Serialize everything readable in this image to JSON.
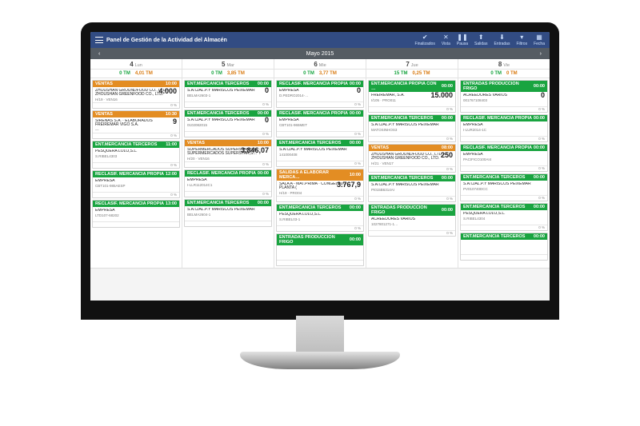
{
  "header": {
    "title": "Panel de Gestión de la Actividad del Almacén",
    "tools": [
      {
        "id": "finalizados",
        "label": "Finalizados",
        "glyph": "✔"
      },
      {
        "id": "vista",
        "label": "Vista",
        "glyph": "✕"
      },
      {
        "id": "pausa",
        "label": "Pausa",
        "glyph": "❚❚"
      },
      {
        "id": "salidas",
        "label": "Salidas",
        "glyph": "⬆"
      },
      {
        "id": "entradas",
        "label": "Entradas",
        "glyph": "⬇"
      },
      {
        "id": "filtros",
        "label": "Filtros",
        "glyph": "▾"
      },
      {
        "id": "fecha",
        "label": "Fecha",
        "glyph": "▦"
      }
    ]
  },
  "datebar": {
    "prev": "‹",
    "label": "Mayo 2015",
    "next": "›"
  },
  "days": [
    {
      "num": "4",
      "dow": "Lun",
      "in": "0 TM",
      "out": "4,01 TM",
      "cards": [
        {
          "cls": "orange",
          "title": "VENTAS",
          "time": "10:00",
          "company": "ZHOUSHAN GROUNDFOOD CO., LTD. · ZHOUSHAN GREENFOOD CO., LTD.",
          "ref": "H/19 · VEN16",
          "amount": "4.000",
          "pct": "0 %"
        },
        {
          "cls": "orange",
          "title": "VENTAS",
          "time": "10:30",
          "company": "SIRENAS S.A. · ELABORADOS FREIREMAR VIGO S.A.",
          "ref": "—",
          "amount": "9",
          "pct": "0 %"
        },
        {
          "cls": "green",
          "title": "ENT.MERCANCIA TERCEROS",
          "time": "11:00",
          "company": "PESQUERA LOLO,S.L.",
          "ref": "S.RIBEL4303",
          "amount": "",
          "pct": "0 %"
        },
        {
          "cls": "green",
          "title": "RECLASIF. MERCANCIA PROPIA",
          "time": "12:00",
          "company": "EMPRESA",
          "ref": "CBT101-985AESP",
          "amount": "",
          "pct": "0 %"
        },
        {
          "cls": "green",
          "title": "RECLASIF. MERCANCIA PROPIA",
          "time": "13:00",
          "company": "EMPRESA",
          "ref": "LTD107-68202",
          "amount": "",
          "pct": ""
        }
      ]
    },
    {
      "num": "5",
      "dow": "Mar",
      "in": "0 TM",
      "out": "3,85 TM",
      "cards": [
        {
          "cls": "green",
          "title": "ENT.MERCANCIA TERCEROS",
          "time": "00:00",
          "company": "S.A.CIAL.P.Y MARISCOS PEIXEMAR",
          "ref": "BELMA2603-1",
          "amount": "0",
          "pct": "0 %"
        },
        {
          "cls": "green",
          "title": "ENT.MERCANCIA TERCEROS",
          "time": "00:00",
          "company": "S.A.CIAL.P.Y MARISCOS PEIXEMAR",
          "ref": "0102082015",
          "amount": "0",
          "pct": "0 %"
        },
        {
          "cls": "orange",
          "title": "VENTAS",
          "time": "10:00",
          "company": "SUPERMERCADOS SUPERSTAR,S.A. · SUPERMERCADOS SUPERSTAR,S…",
          "ref": "H/20 · VEN16",
          "amount": "3.846,07",
          "pct": "0 %"
        },
        {
          "cls": "green",
          "title": "RECLASIF. MERCANCIA PROPIA",
          "time": "00:00",
          "company": "EMPRESA",
          "ref": "I-LLR112014C1",
          "amount": "",
          "pct": "0 %"
        },
        {
          "cls": "green",
          "title": "ENT.MERCANCIA TERCEROS",
          "time": "00:00",
          "company": "S.A.CIAL.P.Y MARISCOS PEIXEMAR",
          "ref": "BELMA2604-1",
          "amount": "",
          "pct": ""
        }
      ]
    },
    {
      "num": "6",
      "dow": "Mie",
      "in": "0 TM",
      "out": "3,77 TM",
      "cards": [
        {
          "cls": "green",
          "title": "RECLASIF. MERCANCIA PROPIA",
          "time": "00:00",
          "company": "EMPRESA",
          "ref": "D.PEDRO2014-…",
          "amount": "0",
          "pct": "0 %"
        },
        {
          "cls": "green",
          "title": "RECLASIF. MERCANCIA PROPIA",
          "time": "00:00",
          "company": "EMPRESA",
          "ref": "CBT101-965MET",
          "amount": "",
          "pct": "0 %"
        },
        {
          "cls": "green",
          "title": "ENT.MERCANCIA TERCEROS",
          "time": "00:00",
          "company": "S.A.CIAL.P.Y MARISCOS PEIXEMAR",
          "ref": "141000408",
          "amount": "",
          "pct": "0 %"
        },
        {
          "cls": "orange",
          "title": "SALIDAS A ELABORAR MERCA…",
          "time": "10:00",
          "company": "SALA A - MAT.PRIMA · CONGELADO PLANTA (",
          "ref": "H/19 · PRO04",
          "amount": "3.767,9",
          "pct": "0 %"
        },
        {
          "cls": "green",
          "title": "ENT.MERCANCIA TERCEROS",
          "time": "00:00",
          "company": "PESQUERA LOLO,S.L.",
          "ref": "S.RIBEL03-1",
          "amount": "",
          "pct": "0 %"
        },
        {
          "cls": "green",
          "title": "ENTRADAS PRODUCCION FRIGO",
          "time": "00:00",
          "company": "",
          "ref": "",
          "amount": "",
          "pct": ""
        }
      ]
    },
    {
      "num": "7",
      "dow": "Jue",
      "in": "15 TM",
      "out": "0,25 TM",
      "cards": [
        {
          "cls": "green",
          "title": "ENT.MERCANCIA PROPIA CON …",
          "time": "00:00",
          "company": "FREIREMAR, S.A.",
          "ref": "I/105 · PRO011",
          "amount": "15.000",
          "pct": "0 %"
        },
        {
          "cls": "green",
          "title": "ENT.MERCANCIA TERCEROS",
          "time": "00:00",
          "company": "S.A.CIAL.P.Y MARISCOS PEIXEMAR",
          "ref": "MATOSINHOS3",
          "amount": "",
          "pct": "0 %"
        },
        {
          "cls": "orange",
          "title": "VENTAS",
          "time": "08:00",
          "company": "ZHOUSHAN GROUNDFOOD CO., LTD. · ZHOUSHAN GREENFOOD CO., LTD.",
          "ref": "H/21 · VEN17",
          "amount": "250",
          "pct": "0 %"
        },
        {
          "cls": "green",
          "title": "ENT.MERCANCIA TERCEROS",
          "time": "00:00",
          "company": "S.A.CIAL.P.Y MARISCOS PEIXEMAR",
          "ref": "PI015B6314AI",
          "amount": "",
          "pct": "0 %"
        },
        {
          "cls": "green",
          "title": "ENTRADAS PRODUCCION FRIGO",
          "time": "00:00",
          "company": "ACREEDORES VARIOS",
          "ref": "1027801271-1…",
          "amount": "",
          "pct": "0 %"
        }
      ]
    },
    {
      "num": "8",
      "dow": "Vie",
      "in": "0 TM",
      "out": "0 TM",
      "cards": [
        {
          "cls": "green",
          "title": "ENTRADAS PRODUCCION FRIGO",
          "time": "00:00",
          "company": "ACREEDORES VARIOS",
          "ref": "001767108403",
          "amount": "0",
          "pct": "0 %"
        },
        {
          "cls": "green",
          "title": "RECLASIF. MERCANCIA PROPIA",
          "time": "00:00",
          "company": "EMPRESA",
          "ref": "I-LUR2014-1C",
          "amount": "",
          "pct": "0 %"
        },
        {
          "cls": "green",
          "title": "RECLASIF. MERCANCIA PROPIA",
          "time": "00:00",
          "company": "EMPRESA",
          "ref": "PACIFICO100AI4",
          "amount": "",
          "pct": "0 %"
        },
        {
          "cls": "green",
          "title": "ENT.MERCANCIA TERCEROS",
          "time": "00:00",
          "company": "S.A.CIAL.P.Y MARISCOS PEIXEMAR",
          "ref": "PV010740DCC",
          "amount": "",
          "pct": "0 %"
        },
        {
          "cls": "green",
          "title": "ENT.MERCANCIA TERCEROS",
          "time": "00:00",
          "company": "PESQUERA LOLO,S.L.",
          "ref": "S.RIBEL4304",
          "amount": "",
          "pct": "0 %"
        },
        {
          "cls": "green",
          "title": "ENT.MERCANCIA TERCEROS",
          "time": "00:00",
          "company": "",
          "ref": "",
          "amount": "",
          "pct": ""
        }
      ]
    }
  ]
}
